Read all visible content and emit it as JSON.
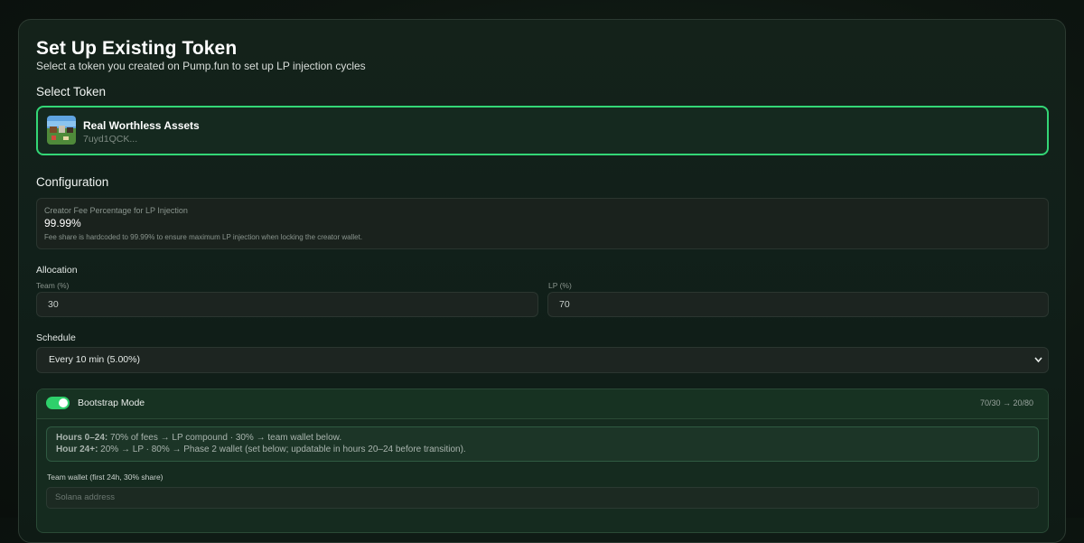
{
  "page": {
    "title": "Set Up Existing Token",
    "subtitle": "Select a token you created on Pump.fun to set up LP injection cycles"
  },
  "select_token": {
    "heading": "Select Token",
    "token": {
      "name": "Real Worthless Assets",
      "address": "7uyd1QCK..."
    }
  },
  "configuration": {
    "heading": "Configuration",
    "fee": {
      "label": "Creator Fee Percentage for LP Injection",
      "value": "99.99%",
      "note": "Fee share is hardcoded to 99.99% to ensure maximum LP injection when locking the creator wallet."
    },
    "allocation": {
      "heading": "Allocation",
      "team_label": "Team (%)",
      "team_value": "30",
      "lp_label": "LP (%)",
      "lp_value": "70"
    },
    "schedule": {
      "heading": "Schedule",
      "selected": "Every 10 min (5.00%)"
    }
  },
  "bootstrap": {
    "title": "Bootstrap Mode",
    "enabled": true,
    "ratio": "70/30 → 20/80",
    "line1_bold": "Hours 0–24:",
    "line1_text": " 70% of fees → LP compound · 30% → team wallet below.",
    "line2_bold": "Hour 24+:",
    "line2_text": " 20% → LP · 80% → Phase 2 wallet (set below; updatable in hours 20–24 before transition).",
    "wallet_label": "Team wallet (first 24h, 30% share)",
    "wallet_placeholder": "Solana address"
  },
  "colors": {
    "accent": "#33d676",
    "background": "#0d1510"
  },
  "icons": {
    "schedule_dropdown": "chevron-down-icon"
  }
}
